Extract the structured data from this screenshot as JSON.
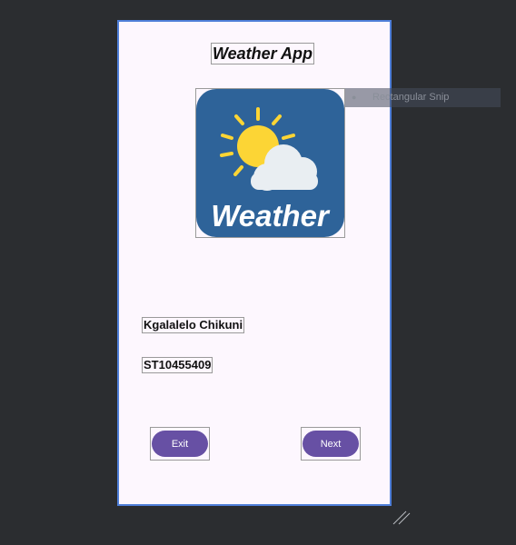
{
  "app": {
    "title": "Weather App",
    "logo_text": "Weather",
    "student_name": "Kgalalelo Chikuni",
    "student_number": "ST10455409"
  },
  "buttons": {
    "exit_label": "Exit",
    "next_label": "Next"
  },
  "overlay": {
    "snip_label": "Rectangular Snip"
  },
  "colors": {
    "background": "#2b2d30",
    "screen": "#fdf7fe",
    "button": "#6750a4",
    "logo_bg": "#2e6399",
    "sun": "#fcd535"
  }
}
